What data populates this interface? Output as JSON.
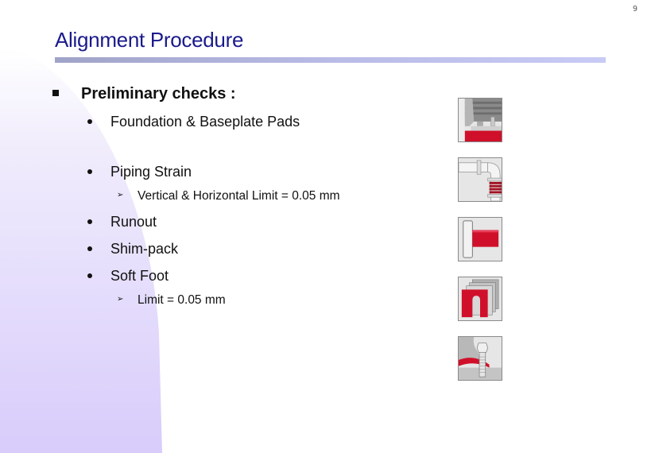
{
  "page_number": "9",
  "title": "Alignment Procedure",
  "colors": {
    "title": "#1a1a8c",
    "accent_red": "#d0102a",
    "bar_start": "#a0a3c8",
    "bar_end": "#c8cbf5"
  },
  "content": {
    "heading": "Preliminary checks :",
    "items": [
      {
        "label": "Foundation & Baseplate Pads"
      },
      {
        "label": "Piping Strain",
        "sub": "Vertical & Horizontal Limit = 0.05 mm"
      },
      {
        "label": "Runout"
      },
      {
        "label": "Shim-pack"
      },
      {
        "label": "Soft Foot",
        "sub": "Limit = 0.05 mm"
      }
    ]
  },
  "icons": [
    {
      "name": "foundation-baseplate-icon"
    },
    {
      "name": "piping-strain-icon"
    },
    {
      "name": "runout-icon"
    },
    {
      "name": "shim-pack-icon"
    },
    {
      "name": "soft-foot-icon"
    }
  ]
}
